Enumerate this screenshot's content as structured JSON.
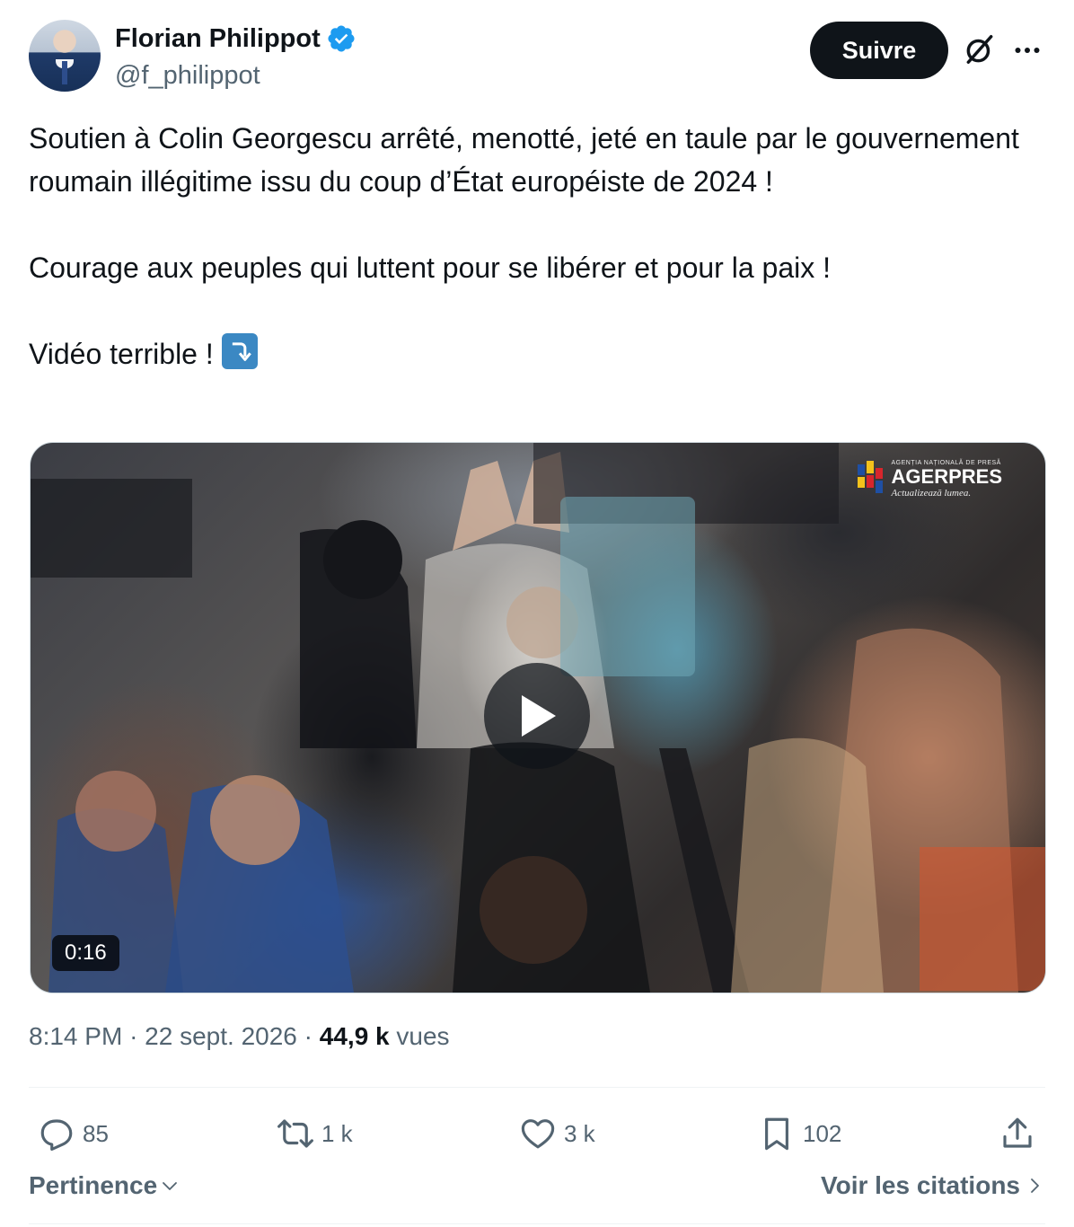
{
  "author": {
    "name": "Florian Philippot",
    "handle": "@f_philippot"
  },
  "header": {
    "follow_label": "Suivre"
  },
  "tweet": {
    "paragraphs": [
      "Soutien à Colin Georgescu arrêté, menotté, jeté en taule par le gouvernement roumain illégitime issu du coup d’État européiste de 2024 !",
      "Courage aux peuples qui luttent pour se libérer et pour la paix !",
      "Vidéo terrible !"
    ]
  },
  "media": {
    "logo_name": "AGERPRES",
    "logo_small": "AGENȚIA NAȚIONALĂ DE PRESĂ",
    "logo_tagline": "Actualizează lumea.",
    "duration": "0:16"
  },
  "meta": {
    "time": "8:14 PM",
    "separator": "·",
    "date": "22 sept. 2026",
    "views_count": "44,9 k",
    "views_label": "vues"
  },
  "actions": {
    "replies": "85",
    "reposts": "1 k",
    "likes": "3 k",
    "bookmarks": "102"
  },
  "footer": {
    "sort_label": "Pertinence",
    "quotes_label": "Voir les citations"
  },
  "colors": {
    "text": "#0f1419",
    "secondary": "#536471",
    "verified": "#1d9bf0",
    "button_bg": "#0f1419"
  },
  "icons": [
    "verified-badge-icon",
    "grok-icon",
    "more-icon",
    "arrow-down-emoji-icon",
    "play-icon",
    "reply-icon",
    "repost-icon",
    "like-icon",
    "bookmark-icon",
    "share-icon",
    "chevron-down-icon",
    "chevron-right-icon"
  ]
}
